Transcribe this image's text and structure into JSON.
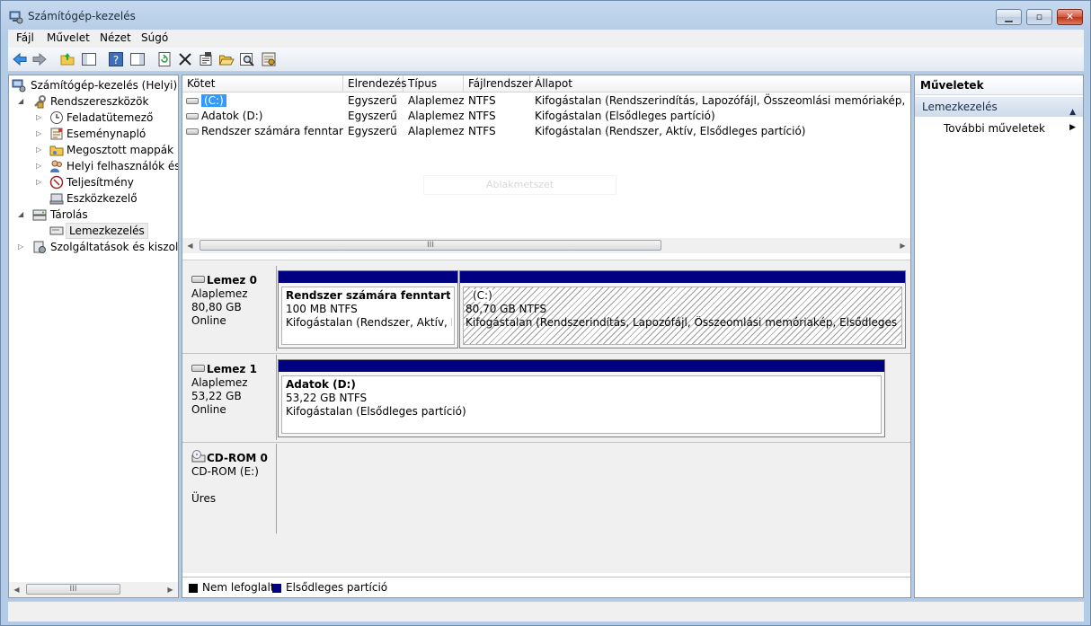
{
  "window": {
    "title": "Számítógép-kezelés"
  },
  "menu": [
    "Fájl",
    "Művelet",
    "Nézet",
    "Súgó"
  ],
  "toolbar": [
    "back-icon",
    "forward-icon",
    "up-folder-icon",
    "show-hide-tree-icon",
    "help-icon",
    "show-hide-action-pane-icon",
    "refresh-icon",
    "delete-icon",
    "properties-icon",
    "open-icon",
    "search-icon",
    "settings-icon"
  ],
  "tree": {
    "items": [
      {
        "label": "Számítógép-kezelés (Helyi)"
      },
      {
        "label": "Rendszereszközök"
      },
      {
        "label": "Feladatütemező"
      },
      {
        "label": "Eseménynapló"
      },
      {
        "label": "Megosztott mappák"
      },
      {
        "label": "Helyi felhasználók és cs"
      },
      {
        "label": "Teljesítmény"
      },
      {
        "label": "Eszközkezelő"
      },
      {
        "label": "Tárolás"
      },
      {
        "label": "Lemezkezelés"
      },
      {
        "label": "Szolgáltatások és kiszolgáló"
      }
    ],
    "scroll_thumb": "III"
  },
  "volumes": {
    "columns": [
      "Kötet",
      "Elrendezés",
      "Típus",
      "Fájlrendszer",
      "Állapot"
    ],
    "rows": [
      {
        "name": "(C:)",
        "layout": "Egyszerű",
        "type": "Alaplemez",
        "fs": "NTFS",
        "status": "Kifogástalan (Rendszerindítás, Lapozófájl, Összeomlási memóriakép, Elsődleges partíció)"
      },
      {
        "name": "Adatok (D:)",
        "layout": "Egyszerű",
        "type": "Alaplemez",
        "fs": "NTFS",
        "status": "Kifogástalan (Elsődleges partíció)"
      },
      {
        "name": "Rendszer számára fenntartott",
        "layout": "Egyszerű",
        "type": "Alaplemez",
        "fs": "NTFS",
        "status": "Kifogástalan (Rendszer, Aktív, Elsődleges partíció)"
      }
    ],
    "watermark": "Ablakmetszet",
    "scroll_thumb": "III"
  },
  "disks": [
    {
      "name": "Lemez 0",
      "kind": "Alaplemez",
      "size": "80,80 GB",
      "state": "Online",
      "partitions": [
        {
          "title": "Rendszer számára fenntartott",
          "size": "100 MB NTFS",
          "status": "Kifogástalan (Rendszer, Aktív, Elsőd"
        },
        {
          "title": "(C:)",
          "size": "80,70 GB NTFS",
          "status": "Kifogástalan (Rendszerindítás, Lapozófájl, Összeomlási memóriakép, Elsődleges partíció)"
        }
      ]
    },
    {
      "name": "Lemez 1",
      "kind": "Alaplemez",
      "size": "53,22 GB",
      "state": "Online",
      "partitions": [
        {
          "title": "Adatok  (D:)",
          "size": "53,22 GB NTFS",
          "status": "Kifogástalan (Elsődleges partíció)"
        }
      ]
    },
    {
      "name": "CD-ROM 0",
      "kind": "CD-ROM (E:)",
      "state": "Üres"
    }
  ],
  "legend": [
    {
      "label": "Nem lefoglalt",
      "color": "#000000"
    },
    {
      "label": "Elsődleges partíció",
      "color": "#000080"
    }
  ],
  "actions": {
    "title": "Műveletek",
    "section": "Lemezkezelés",
    "item": "További műveletek"
  },
  "colors": {
    "primary_partition": "#000080",
    "selection": "#3399ff"
  }
}
